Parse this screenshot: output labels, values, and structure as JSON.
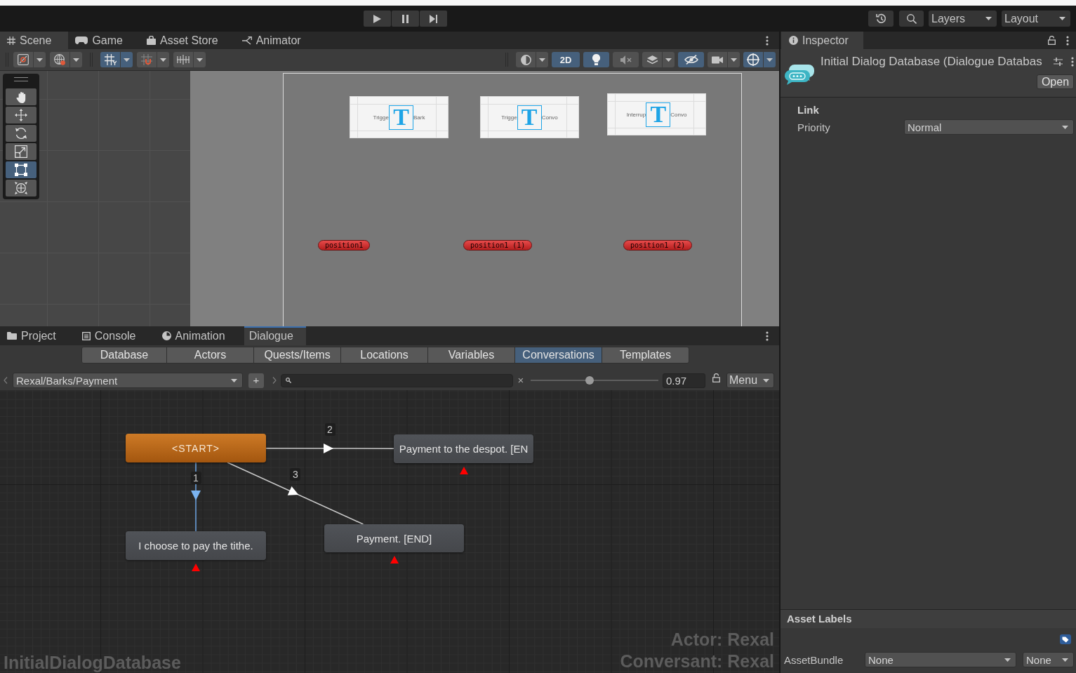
{
  "toolbar": {
    "play_controls": [
      {
        "kind": "play"
      },
      {
        "kind": "pause"
      },
      {
        "kind": "step"
      }
    ],
    "layers": "Layers",
    "layout": "Layout"
  },
  "scene_panel": {
    "tabs": [
      {
        "kind": "scene",
        "label": "Scene",
        "selected": true
      },
      {
        "kind": "game",
        "label": "Game",
        "selected": false
      },
      {
        "kind": "asset-store",
        "label": "Asset Store",
        "selected": false
      },
      {
        "kind": "animator",
        "label": "Animator",
        "selected": false
      }
    ],
    "toolbar_left": [
      {
        "kind": "draw-mode",
        "on": false,
        "dropdown": true
      },
      {
        "kind": "globe",
        "on": false,
        "dropdown": true
      },
      {
        "kind": "grid",
        "on": true,
        "dropdown": true
      },
      {
        "kind": "snap",
        "on": false,
        "dropdown": true
      },
      {
        "kind": "increment",
        "on": false,
        "dropdown": true
      }
    ],
    "toolbar_right": [
      {
        "kind": "shading",
        "on": false,
        "dropdown": true
      },
      {
        "kind": "text",
        "label": "2D",
        "on": true,
        "dropdown": false
      },
      {
        "kind": "lighting",
        "on": true,
        "dropdown": false
      },
      {
        "kind": "audio",
        "on": false,
        "dropdown": false
      },
      {
        "kind": "effects",
        "on": false,
        "dropdown": true
      },
      {
        "kind": "visibility",
        "on": true,
        "dropdown": false
      },
      {
        "kind": "camera",
        "on": false,
        "dropdown": true
      },
      {
        "kind": "gizmos",
        "on": true,
        "dropdown": true
      }
    ],
    "tools": [
      {
        "kind": "hand",
        "selected": false
      },
      {
        "kind": "move",
        "selected": false
      },
      {
        "kind": "rotate",
        "selected": false
      },
      {
        "kind": "scale",
        "selected": false
      },
      {
        "kind": "rect",
        "selected": true
      },
      {
        "kind": "transform",
        "selected": false
      }
    ],
    "text_objects": [
      {
        "glyph": "T",
        "label_parts": [
          "Trigge",
          "Bark"
        ]
      },
      {
        "glyph": "T",
        "label_parts": [
          "Trigge",
          "Convo"
        ]
      },
      {
        "glyph": "T",
        "label_parts": [
          "Interrup",
          "Convo"
        ]
      }
    ],
    "markers": [
      "position1",
      "position1 (1)",
      "position1 (2)"
    ]
  },
  "bottom_panel": {
    "tabs": [
      {
        "kind": "project",
        "label": "Project",
        "selected": false
      },
      {
        "kind": "console",
        "label": "Console",
        "selected": false
      },
      {
        "kind": "animation",
        "label": "Animation",
        "selected": false
      },
      {
        "kind": "dialogue",
        "label": "Dialogue",
        "selected": true
      }
    ],
    "editor_tabs": [
      {
        "label": "Database",
        "selected": false
      },
      {
        "label": "Actors",
        "selected": false
      },
      {
        "label": "Quests/Items",
        "selected": false
      },
      {
        "label": "Locations",
        "selected": false
      },
      {
        "label": "Variables",
        "selected": false
      },
      {
        "label": "Conversations",
        "selected": true
      },
      {
        "label": "Templates",
        "selected": false
      }
    ],
    "conversation": "Rexal/Barks/Payment",
    "add_button": "+",
    "clear_button": "×",
    "zoom": {
      "level": 0.46,
      "value": "0.97"
    },
    "menu": "Menu",
    "graph": {
      "nodes": [
        {
          "kind": "start",
          "label": "<START>"
        },
        {
          "kind": "entry",
          "label": "Payment to the despot. [EN"
        },
        {
          "kind": "entry",
          "label": "I choose to pay the tithe."
        },
        {
          "kind": "entry",
          "label": "Payment. [END]"
        }
      ],
      "links": [
        {
          "label": "1",
          "selected": true
        },
        {
          "label": "2",
          "selected": false
        },
        {
          "label": "3",
          "selected": false
        }
      ],
      "actor": "Actor: Rexal",
      "conversant": "Conversant: Rexal",
      "database": "InitialDialogDatabase"
    }
  },
  "inspector": {
    "tab": {
      "label": "Inspector",
      "selected": true
    },
    "title": "Initial Dialog Database (Dialogue Databas",
    "open_button": "Open",
    "section": "Link",
    "fields": [
      {
        "label": "Priority",
        "value": "Normal"
      }
    ],
    "asset_labels": "Asset Labels",
    "asset_bundle": {
      "label": "AssetBundle",
      "value": "None",
      "variant": "None"
    }
  }
}
